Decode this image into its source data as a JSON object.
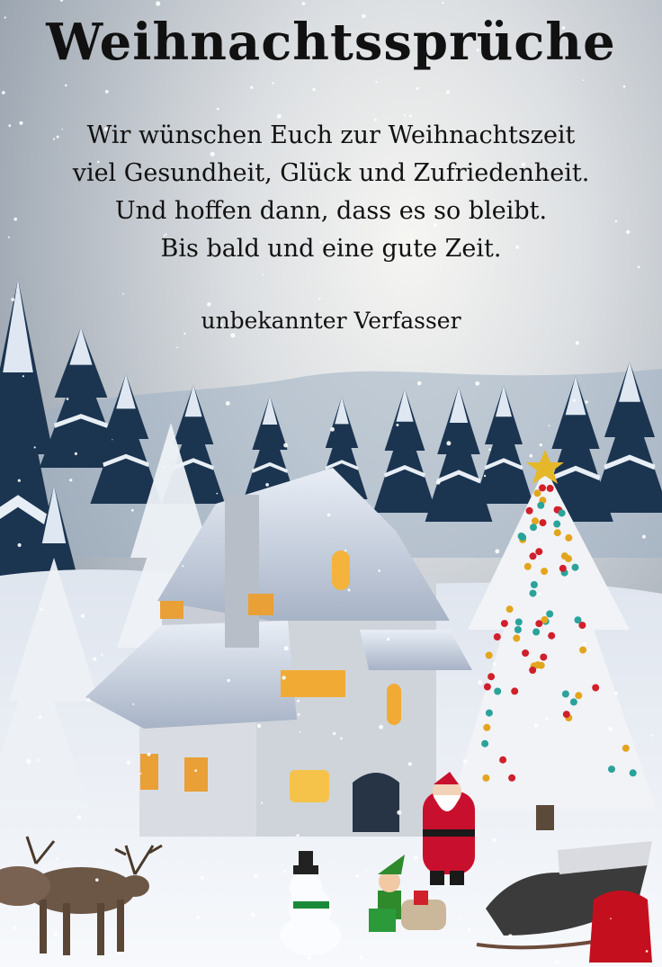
{
  "card": {
    "title": "Weihnachtssprüche",
    "verse_lines": [
      "Wir wünschen Euch zur Weihnachtszeit",
      "viel Gesundheit, Glück und Zufriedenheit.",
      "Und hoffen dann, dass es so bleibt.",
      "Bis bald und eine gute Zeit."
    ],
    "author": "unbekannter Verfasser"
  },
  "colors": {
    "sky_top": "#b9c1cc",
    "sky_glow": "#f4f4f2",
    "snow": "#f2f4f8",
    "pine": "#1d3650",
    "window_light": "#f5b53a",
    "ornament_red": "#d0202c",
    "ornament_gold": "#e3a51c",
    "ornament_teal": "#2aa39a",
    "santa_red": "#c8102e"
  }
}
